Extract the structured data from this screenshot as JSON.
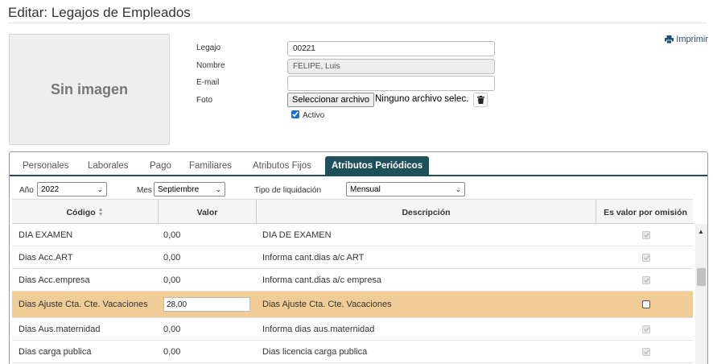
{
  "page": {
    "title": "Editar: Legajos de Empleados"
  },
  "photo": {
    "placeholder": "Sin imagen"
  },
  "print": {
    "label": "Imprimir"
  },
  "form": {
    "legajo_label": "Legajo",
    "legajo_value": "00221",
    "nombre_label": "Nombre",
    "nombre_value": "FELIPE, Luis",
    "email_label": "E-mail",
    "email_value": "",
    "foto_label": "Foto",
    "file_button": "Seleccionar archivo",
    "file_status": "Ninguno archivo selec.",
    "activo_label": "Activo",
    "activo_checked": true
  },
  "tabs": [
    {
      "label": "Personales",
      "active": false
    },
    {
      "label": "Laborales",
      "active": false
    },
    {
      "label": "Pago",
      "active": false
    },
    {
      "label": "Familiares",
      "active": false
    },
    {
      "label": "Atributos Fijos",
      "active": false
    },
    {
      "label": "Atributos Periódicos",
      "active": true
    }
  ],
  "filters": {
    "anio_label": "Año",
    "anio_value": "2022",
    "mes_label": "Mes",
    "mes_value": "Septiembre",
    "tipo_label": "Tipo de liquidación",
    "tipo_value": "Mensual"
  },
  "table": {
    "headers": {
      "codigo": "Código",
      "valor": "Valor",
      "descripcion": "Descripción",
      "omision": "Es valor por omisión"
    },
    "rows": [
      {
        "codigo": "DIA EXAMEN",
        "valor": "0,00",
        "descripcion": "DIA DE EXAMEN",
        "omision": true,
        "selected": false
      },
      {
        "codigo": "Dias Acc.ART",
        "valor": "0,00",
        "descripcion": "Informa cant.dias a/c ART",
        "omision": true,
        "selected": false
      },
      {
        "codigo": "Dias Acc.empresa",
        "valor": "0,00",
        "descripcion": "Informa cant.dias a/c empresa",
        "omision": true,
        "selected": false
      },
      {
        "codigo": "Dias Ajuste Cta. Cte. Vacaciones",
        "valor": "28,00",
        "descripcion": "Dias Ajuste Cta. Cte. Vacaciones",
        "omision": false,
        "selected": true
      },
      {
        "codigo": "Dias Aus.maternidad",
        "valor": "0,00",
        "descripcion": "Informa dias aus.maternidad",
        "omision": true,
        "selected": false
      },
      {
        "codigo": "Dias carga publica",
        "valor": "0,00",
        "descripcion": "Dias licencia carga publica",
        "omision": true,
        "selected": false
      }
    ]
  },
  "colors": {
    "tab_active": "#1d5059",
    "row_selected": "#f0cd96",
    "link": "#1f4e79"
  }
}
